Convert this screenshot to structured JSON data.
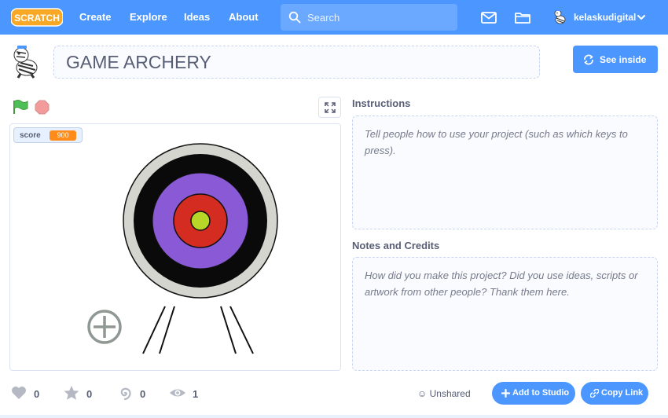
{
  "nav": {
    "logo_text": "SCRATCH",
    "links": [
      "Create",
      "Explore",
      "Ideas",
      "About"
    ],
    "search_placeholder": "Search",
    "username": "kelaskudigital"
  },
  "project": {
    "title": "GAME ARCHERY",
    "see_inside_label": "See inside"
  },
  "stage": {
    "monitor_label": "score",
    "monitor_value": "900"
  },
  "instructions": {
    "heading": "Instructions",
    "placeholder": "Tell people how to use your project (such as which keys to press)."
  },
  "notes": {
    "heading": "Notes and Credits",
    "placeholder": "How did you make this project? Did you use ideas, scripts or artwork from other people? Thank them here."
  },
  "stats": {
    "loves": "0",
    "favorites": "0",
    "remixes": "0",
    "views": "1"
  },
  "share": {
    "status": "Unshared",
    "add_to_studio_label": "Add to Studio",
    "copy_link_label": "Copy Link"
  },
  "icons": {
    "search": "search-icon",
    "messages": "envelope-icon",
    "my_stuff": "folder-icon",
    "chevron": "chevron-down-icon",
    "see_inside": "see-inside-icon",
    "flag": "green-flag-icon",
    "stop": "stop-icon",
    "fullscreen": "fullscreen-icon",
    "love": "heart-icon",
    "favorite": "star-icon",
    "remix": "remix-spiral-icon",
    "views": "eye-icon",
    "unshared": "unshared-icon",
    "add": "plus-icon",
    "link": "link-icon"
  },
  "colors": {
    "brand_blue": "#4c97ff",
    "logo_orange": "#f9a825",
    "monitor_orange": "#ff8c1a",
    "flag_green": "#4cbf56",
    "stop_red": "#ec5959"
  }
}
